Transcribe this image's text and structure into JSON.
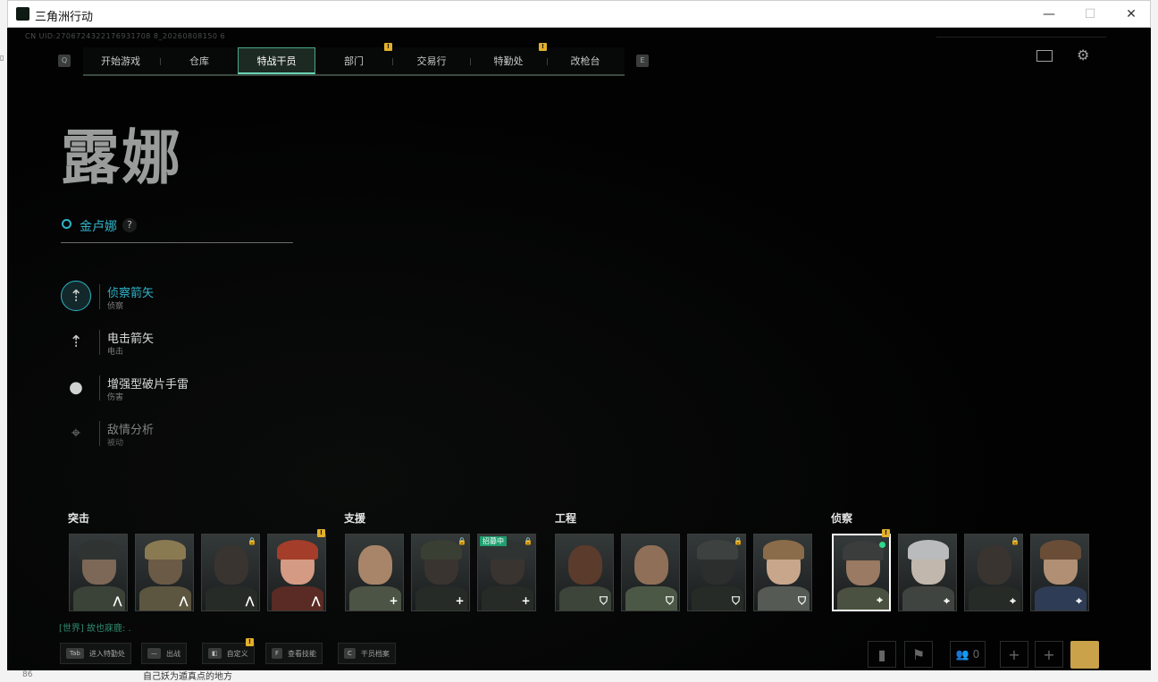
{
  "window": {
    "title": "三角洲行动"
  },
  "uid": "CN UID:2706724322176931708 8_20260808150 6",
  "nav": {
    "left_key": "Q",
    "right_key": "E",
    "tabs": [
      {
        "label": "开始游戏"
      },
      {
        "label": "仓库"
      },
      {
        "label": "特战干员"
      },
      {
        "label": "部门"
      },
      {
        "label": "交易行"
      },
      {
        "label": "特勤处"
      },
      {
        "label": "改枪台"
      }
    ],
    "active_tab": "特战干员"
  },
  "operator": {
    "name": "露娜",
    "codename": "金卢娜",
    "help": "?",
    "skills": [
      {
        "name": "侦察箭矢",
        "sub": "侦察",
        "icon": "arrow-icon",
        "active": true
      },
      {
        "name": "电击箭矢",
        "sub": "电击",
        "icon": "arrow-icon",
        "active": false
      },
      {
        "name": "增强型破片手雷",
        "sub": "伤害",
        "icon": "grenade-icon",
        "active": false
      },
      {
        "name": "敌情分析",
        "sub": "被动",
        "icon": "crosshair-icon",
        "active": false
      }
    ]
  },
  "categories": [
    {
      "label": "突击"
    },
    {
      "label": "支援"
    },
    {
      "label": "工程"
    },
    {
      "label": "侦察"
    }
  ],
  "recruit_badge": "招募中",
  "chat": "[世界] 故也寐鹿: .",
  "hints": [
    {
      "key": "Tab",
      "label": "进入特勤处"
    },
    {
      "key": "—",
      "label": "出战"
    },
    {
      "key": "◧",
      "label": "自定义"
    },
    {
      "key": "F",
      "label": "查看技能"
    },
    {
      "key": "C",
      "label": "干员档案"
    }
  ],
  "friends_count": "0",
  "colors": {
    "accent": "#2fb4c8",
    "warning": "#e3b02b",
    "recruit": "#1f9f6f"
  },
  "background_text": {
    "line_number": "86",
    "snippet": "自己妖为遁真点的地方"
  }
}
